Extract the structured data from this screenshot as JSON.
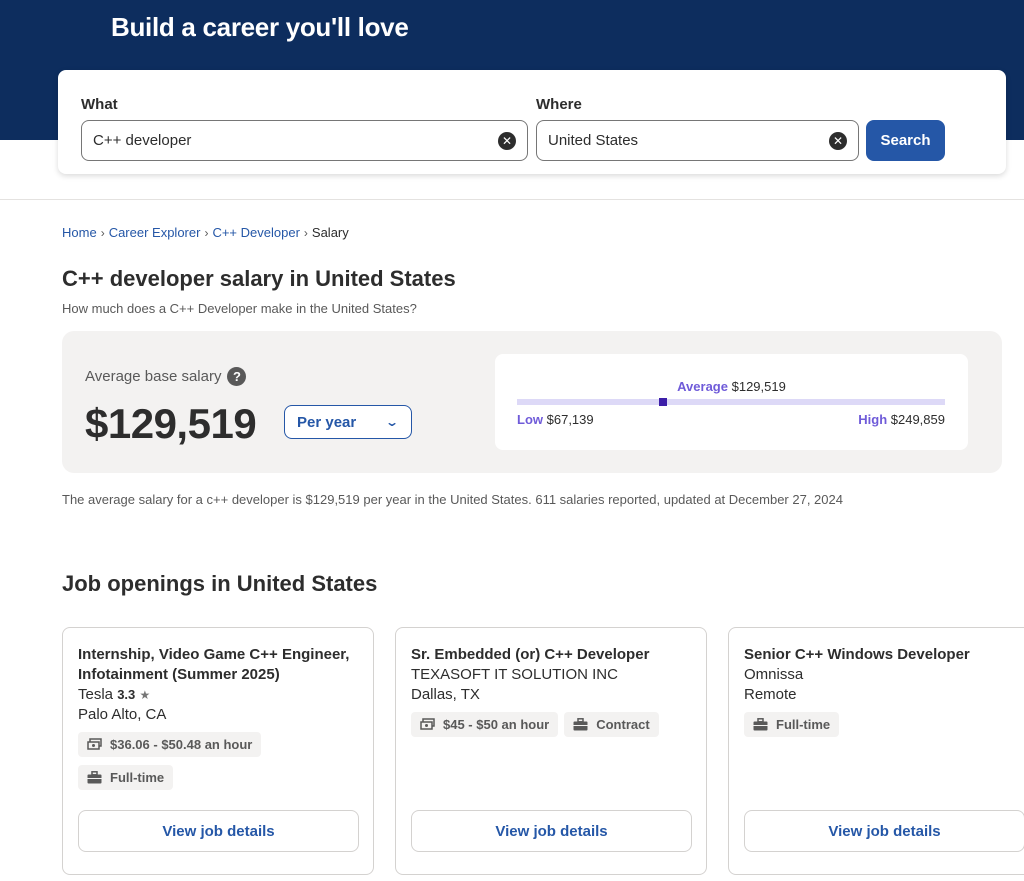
{
  "hero": {
    "title": "Build a career you'll love"
  },
  "search": {
    "what_label": "What",
    "what_value": "C++ developer",
    "where_label": "Where",
    "where_value": "United States",
    "button_label": "Search"
  },
  "breadcrumb": [
    "Home",
    "Career Explorer",
    "C++ Developer",
    "Salary"
  ],
  "page": {
    "title": "C++ developer salary in United States",
    "subtitle": "How much does a C++ Developer make in the United States?"
  },
  "salary": {
    "avg_label": "Average base salary",
    "help_glyph": "?",
    "amount": "$129,519",
    "period": "Per year",
    "range": {
      "avg_label": "Average",
      "avg_value": "$129,519",
      "low_label": "Low",
      "low_value": "$67,139",
      "high_label": "High",
      "high_value": "$249,859",
      "marker_fraction": 0.34
    },
    "summary": "The average salary for a c++ developer is $129,519 per year in the United States.  611 salaries reported, updated at December 27, 2024"
  },
  "jobs": {
    "section_title": "Job openings in United States",
    "button_label": "View job details",
    "items": [
      {
        "title": "Internship, Video Game C++ Engineer, Infotainment (Summer 2025)",
        "company": "Tesla",
        "rating": "3.3",
        "location": "Palo Alto, CA",
        "pay": "$36.06 - $50.48 an hour",
        "job_type": "Full-time"
      },
      {
        "title": "Sr. Embedded (or) C++ Developer",
        "company": "TEXASOFT IT SOLUTION INC",
        "location": "Dallas, TX",
        "pay": "$45 - $50 an hour",
        "job_type": "Contract"
      },
      {
        "title": "Senior C++ Windows Developer",
        "company": "Omnissa",
        "location": "Remote",
        "job_type": "Full-time"
      }
    ]
  },
  "colors": {
    "hero_bg": "#0d2d5e",
    "brand_blue": "#2557a7",
    "range_accent": "#6f5bd9",
    "panel_bg": "#f3f2f1"
  }
}
